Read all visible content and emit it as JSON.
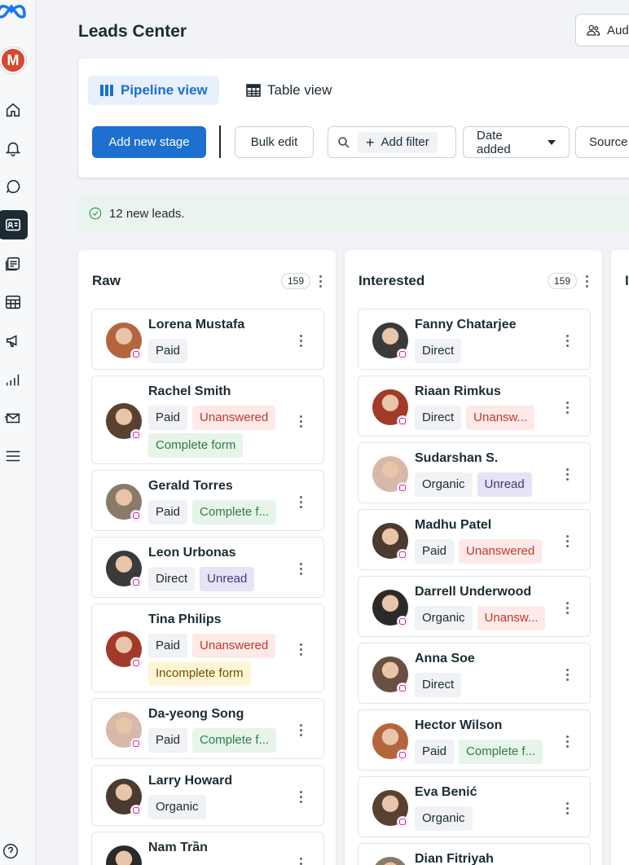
{
  "sidebar": {
    "avatar_letter": "M",
    "icons": [
      "home-icon",
      "bell-icon",
      "chat-icon",
      "leads-icon",
      "inbox-icon",
      "table-icon",
      "megaphone-icon",
      "chart-icon",
      "mail-icon",
      "menu-icon"
    ],
    "help_icon": "help-icon"
  },
  "header": {
    "title": "Leads Center",
    "audience_button": "Aud"
  },
  "toolbar": {
    "pipeline_view": "Pipeline view",
    "table_view": "Table view",
    "add_stage": "Add new stage",
    "bulk_edit": "Bulk edit",
    "add_filter": "Add filter",
    "date_added": "Date added",
    "source": "Source"
  },
  "banner": {
    "text": "12 new leads."
  },
  "colors": {
    "primary": "#1d6fd0",
    "tag_red": "#c0392b",
    "tag_green": "#2e7d4a",
    "tag_purple": "#3f3a7a"
  },
  "columns": [
    {
      "title": "Raw",
      "count": "159",
      "cards": [
        {
          "name": "Lorena Mustafa",
          "tags": [
            [
              "Paid",
              "gray"
            ]
          ]
        },
        {
          "name": "Rachel Smith",
          "tags": [
            [
              "Paid",
              "gray"
            ],
            [
              "Unanswered",
              "red"
            ],
            [
              "Complete form",
              "green"
            ]
          ]
        },
        {
          "name": "Gerald Torres",
          "tags": [
            [
              "Paid",
              "gray"
            ],
            [
              "Complete f...",
              "green"
            ]
          ]
        },
        {
          "name": "Leon Urbonas",
          "tags": [
            [
              "Direct",
              "gray"
            ],
            [
              "Unread",
              "purple"
            ]
          ]
        },
        {
          "name": "Tina Philips",
          "tags": [
            [
              "Paid",
              "gray"
            ],
            [
              "Unanswered",
              "red"
            ],
            [
              "Incomplete form",
              "yellow"
            ]
          ]
        },
        {
          "name": "Da-yeong Song",
          "tags": [
            [
              "Paid",
              "gray"
            ],
            [
              "Complete f...",
              "green"
            ]
          ]
        },
        {
          "name": "Larry Howard",
          "tags": [
            [
              "Organic",
              "gray"
            ]
          ]
        },
        {
          "name": "Nam Trần",
          "tags": []
        }
      ]
    },
    {
      "title": "Interested",
      "count": "159",
      "cards": [
        {
          "name": "Fanny Chatarjee",
          "tags": [
            [
              "Direct",
              "gray"
            ]
          ]
        },
        {
          "name": "Riaan Rimkus",
          "tags": [
            [
              "Direct",
              "gray"
            ],
            [
              "Unansw...",
              "red"
            ]
          ]
        },
        {
          "name": "Sudarshan S.",
          "tags": [
            [
              "Organic",
              "gray"
            ],
            [
              "Unread",
              "purple"
            ]
          ]
        },
        {
          "name": "Madhu Patel",
          "tags": [
            [
              "Paid",
              "gray"
            ],
            [
              "Unanswered",
              "red"
            ]
          ]
        },
        {
          "name": "Darrell Underwood",
          "tags": [
            [
              "Organic",
              "gray"
            ],
            [
              "Unansw...",
              "red"
            ]
          ]
        },
        {
          "name": "Anna Soe",
          "tags": [
            [
              "Direct",
              "gray"
            ]
          ]
        },
        {
          "name": "Hector Wilson",
          "tags": [
            [
              "Paid",
              "gray"
            ],
            [
              "Complete f...",
              "green"
            ]
          ]
        },
        {
          "name": "Eva Benić",
          "tags": [
            [
              "Organic",
              "gray"
            ]
          ]
        },
        {
          "name": "Dian Fitriyah",
          "tags": []
        }
      ]
    },
    {
      "title": "I",
      "count": "",
      "cards": []
    }
  ]
}
